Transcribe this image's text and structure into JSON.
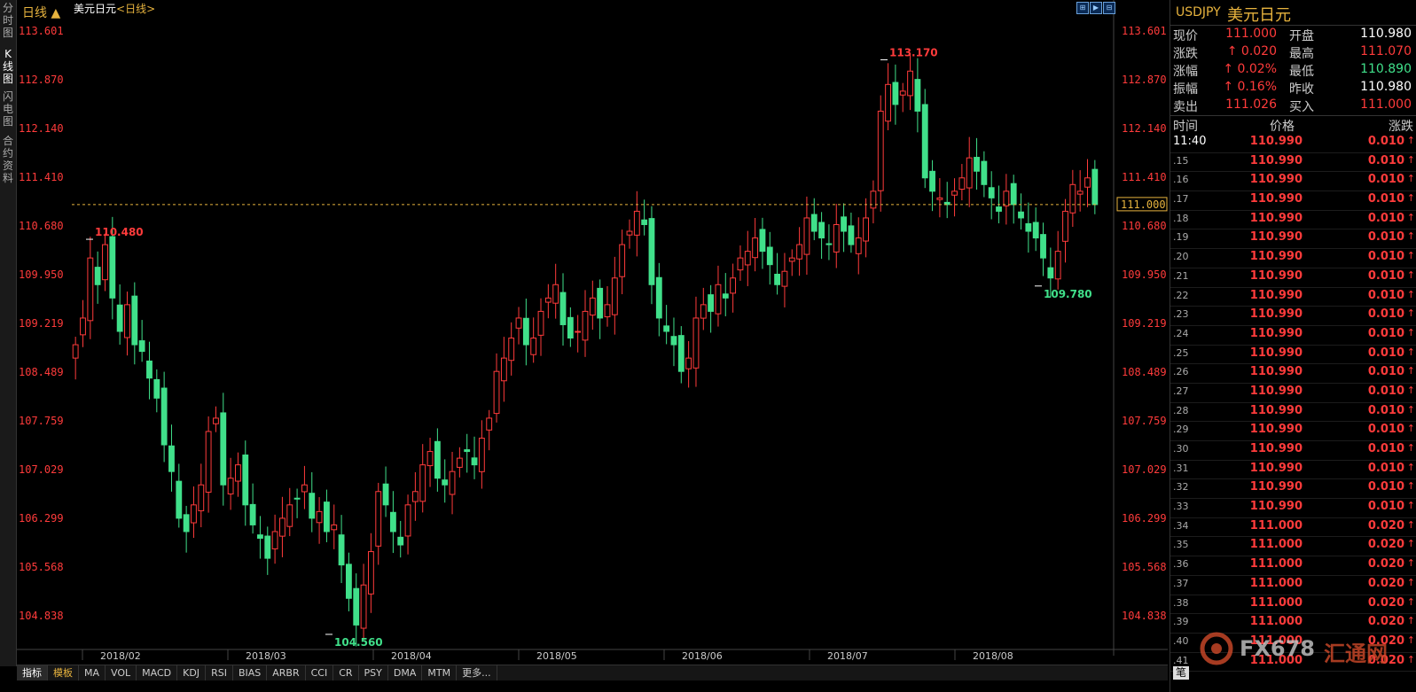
{
  "left_tabs": [
    {
      "label": "分时图",
      "active": false
    },
    {
      "label": "K线图",
      "active": true
    },
    {
      "label": "闪电图",
      "active": false
    },
    {
      "label": "合约资料",
      "active": false
    }
  ],
  "chart": {
    "title": "美元日元",
    "period_label": "<日线>",
    "period_button": "日线 ▲",
    "y_ticks": [
      "113.601",
      "112.870",
      "112.140",
      "111.410",
      "110.680",
      "109.950",
      "109.219",
      "108.489",
      "107.759",
      "107.029",
      "106.299",
      "105.568",
      "104.838"
    ],
    "x_ticks": [
      "2018/02",
      "2018/03",
      "2018/04",
      "2018/05",
      "2018/06",
      "2018/07",
      "2018/08"
    ],
    "annotations": {
      "high": "113.170",
      "low": "104.560",
      "left_high": "110.480",
      "recent_low": "109.780"
    },
    "current_price_label": "111.000",
    "colors": {
      "up": "#ff3b3b",
      "down": "#40e08a",
      "axis_text": "#ff3b3b",
      "grid": "#333",
      "current_line": "#e7b33e"
    }
  },
  "chart_data": {
    "type": "candlestick",
    "x_labels": [
      "2018/02",
      "2018/03",
      "2018/04",
      "2018/05",
      "2018/06",
      "2018/07",
      "2018/08"
    ],
    "ylim": [
      104.4,
      113.8
    ],
    "current_price": 111.0,
    "high": 113.17,
    "low": 104.56,
    "annotated_points": {
      "left_high": 110.48,
      "recent_low": 109.78
    },
    "close_path": [
      108.9,
      109.3,
      110.2,
      109.8,
      110.4,
      109.6,
      109.1,
      109.5,
      108.9,
      108.8,
      108.4,
      108.1,
      107.4,
      107.0,
      106.3,
      106.1,
      106.5,
      106.8,
      107.6,
      107.8,
      106.8,
      106.9,
      107.1,
      106.5,
      106.2,
      106.0,
      105.7,
      106.1,
      106.3,
      106.5,
      106.6,
      106.8,
      106.3,
      106.4,
      106.1,
      106.2,
      105.6,
      105.1,
      104.7,
      105.3,
      105.8,
      106.7,
      106.5,
      106.1,
      105.9,
      106.5,
      106.7,
      107.1,
      107.3,
      106.9,
      106.8,
      107.0,
      107.2,
      107.3,
      107.1,
      107.5,
      107.8,
      108.5,
      108.7,
      109.0,
      109.3,
      108.9,
      109.0,
      109.4,
      109.6,
      109.8,
      109.2,
      109.0,
      109.1,
      109.4,
      109.6,
      109.3,
      109.5,
      109.9,
      110.4,
      110.6,
      110.9,
      110.7,
      109.8,
      109.3,
      109.1,
      108.9,
      108.5,
      108.7,
      109.3,
      109.5,
      109.4,
      109.8,
      109.6,
      109.9,
      110.2,
      110.3,
      110.5,
      110.3,
      110.1,
      109.8,
      110.0,
      110.2,
      110.4,
      110.8,
      110.6,
      110.5,
      110.4,
      110.7,
      110.6,
      110.4,
      110.5,
      110.8,
      111.2,
      112.4,
      112.8,
      112.5,
      112.7,
      113.0,
      112.4,
      111.4,
      111.2,
      111.1,
      111.0,
      111.2,
      111.4,
      111.7,
      111.5,
      111.3,
      111.1,
      110.9,
      111.2,
      111.0,
      110.8,
      110.6,
      110.5,
      110.2,
      109.9,
      110.3,
      110.9,
      111.3,
      111.2,
      111.4,
      111.0
    ]
  },
  "quote": {
    "symbol_code": "USDJPY",
    "symbol_name": "美元日元",
    "rows": [
      {
        "l1": "现价",
        "v1": "111.000",
        "c1": "red",
        "arrow1": false,
        "l2": "开盘",
        "v2": "110.980",
        "c2": "white"
      },
      {
        "l1": "涨跌",
        "v1": "0.020",
        "c1": "red",
        "arrow1": true,
        "l2": "最高",
        "v2": "111.070",
        "c2": "red"
      },
      {
        "l1": "涨幅",
        "v1": "0.02%",
        "c1": "red",
        "arrow1": true,
        "l2": "最低",
        "v2": "110.890",
        "c2": "green"
      },
      {
        "l1": "振幅",
        "v1": "0.16%",
        "c1": "red",
        "arrow1": true,
        "l2": "昨收",
        "v2": "110.980",
        "c2": "white"
      },
      {
        "l1": "卖出",
        "v1": "111.026",
        "c1": "red",
        "arrow1": false,
        "l2": "买入",
        "v2": "111.000",
        "c2": "red"
      }
    ],
    "ticks_header": {
      "time": "时间",
      "price": "价格",
      "change": "涨跌"
    },
    "ticks": [
      {
        "time": "11:40",
        "price": "110.990",
        "chg": "0.010",
        "big": true
      },
      {
        "time": ".15",
        "price": "110.990",
        "chg": "0.010"
      },
      {
        "time": ".16",
        "price": "110.990",
        "chg": "0.010"
      },
      {
        "time": ".17",
        "price": "110.990",
        "chg": "0.010"
      },
      {
        "time": ".18",
        "price": "110.990",
        "chg": "0.010"
      },
      {
        "time": ".19",
        "price": "110.990",
        "chg": "0.010"
      },
      {
        "time": ".20",
        "price": "110.990",
        "chg": "0.010"
      },
      {
        "time": ".21",
        "price": "110.990",
        "chg": "0.010"
      },
      {
        "time": ".22",
        "price": "110.990",
        "chg": "0.010"
      },
      {
        "time": ".23",
        "price": "110.990",
        "chg": "0.010"
      },
      {
        "time": ".24",
        "price": "110.990",
        "chg": "0.010"
      },
      {
        "time": ".25",
        "price": "110.990",
        "chg": "0.010"
      },
      {
        "time": ".26",
        "price": "110.990",
        "chg": "0.010"
      },
      {
        "time": ".27",
        "price": "110.990",
        "chg": "0.010"
      },
      {
        "time": ".28",
        "price": "110.990",
        "chg": "0.010"
      },
      {
        "time": ".29",
        "price": "110.990",
        "chg": "0.010"
      },
      {
        "time": ".30",
        "price": "110.990",
        "chg": "0.010"
      },
      {
        "time": ".31",
        "price": "110.990",
        "chg": "0.010"
      },
      {
        "time": ".32",
        "price": "110.990",
        "chg": "0.010"
      },
      {
        "time": ".33",
        "price": "110.990",
        "chg": "0.010"
      },
      {
        "time": ".34",
        "price": "111.000",
        "chg": "0.020"
      },
      {
        "time": ".35",
        "price": "111.000",
        "chg": "0.020"
      },
      {
        "time": ".36",
        "price": "111.000",
        "chg": "0.020"
      },
      {
        "time": ".37",
        "price": "111.000",
        "chg": "0.020"
      },
      {
        "time": ".38",
        "price": "111.000",
        "chg": "0.020"
      },
      {
        "time": ".39",
        "price": "111.000",
        "chg": "0.020"
      },
      {
        "time": ".40",
        "price": "111.000",
        "chg": "0.020"
      },
      {
        "time": ".41",
        "price": "111.000",
        "chg": "0.020"
      }
    ],
    "brush_tab": "笔"
  },
  "indicators": [
    "指标",
    "模板",
    "MA",
    "VOL",
    "MACD",
    "KDJ",
    "RSI",
    "BIAS",
    "ARBR",
    "CCI",
    "CR",
    "PSY",
    "DMA",
    "MTM",
    "更多..."
  ],
  "watermark": {
    "text": "FX678",
    "cn": "汇通网"
  }
}
